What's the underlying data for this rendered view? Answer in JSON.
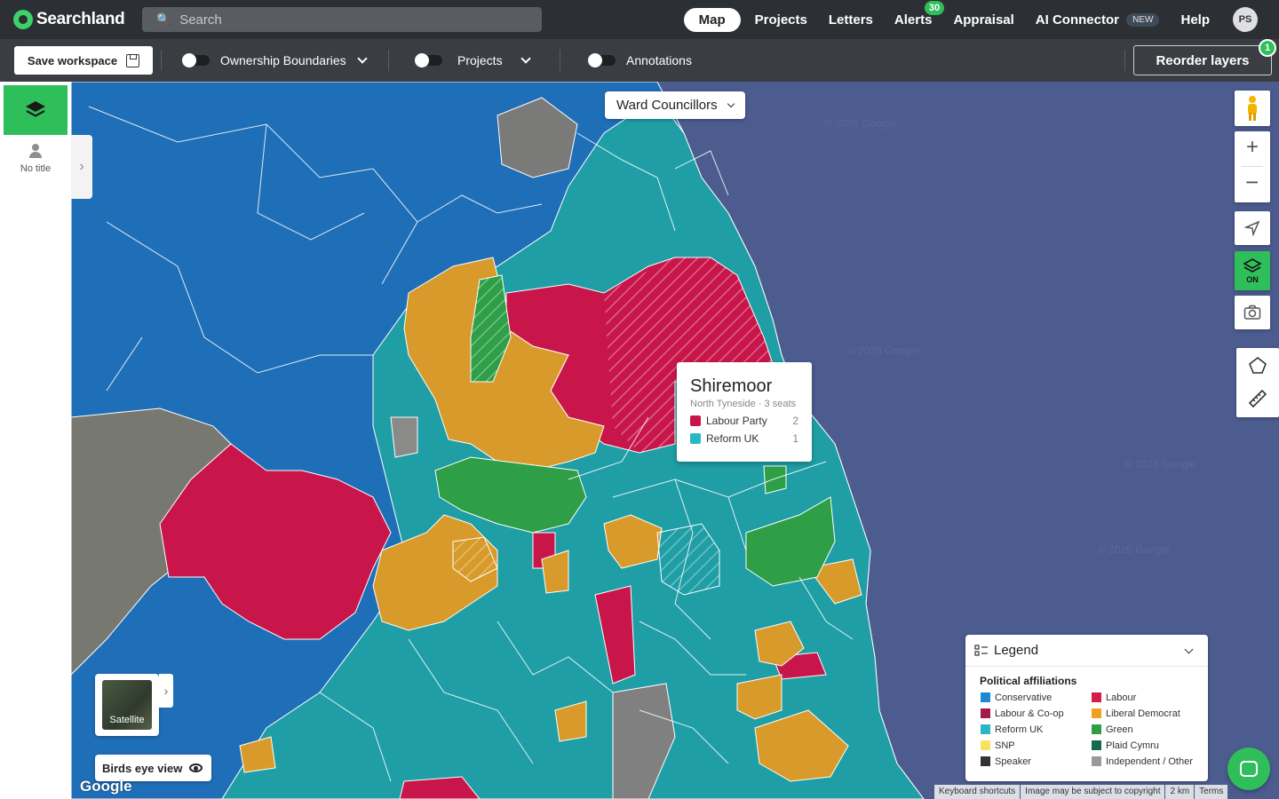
{
  "brand": {
    "name": "Searchland"
  },
  "search": {
    "placeholder": "Search"
  },
  "nav": {
    "map": "Map",
    "projects": "Projects",
    "letters": "Letters",
    "alerts": "Alerts",
    "alerts_count": "30",
    "appraisal": "Appraisal",
    "ai_connector": "AI Connector",
    "new_badge": "NEW",
    "help": "Help",
    "avatar_initials": "PS"
  },
  "toolbar": {
    "save_label": "Save workspace",
    "ownership": "Ownership Boundaries",
    "projects": "Projects",
    "annotations": "Annotations",
    "reorder_label": "Reorder layers",
    "reorder_count": "1"
  },
  "left_panel": {
    "workspace_title": "No title"
  },
  "map": {
    "layer_dropdown": "Ward Councillors",
    "layers_toggle_state": "ON",
    "popup": {
      "title": "Shiremoor",
      "subtitle": "North Tyneside · 3 seats",
      "rows": [
        {
          "party": "Labour Party",
          "count": "2",
          "color": "#c8164a"
        },
        {
          "party": "Reform UK",
          "count": "1",
          "color": "#2bb6c6"
        }
      ]
    },
    "satellite_label": "Satellite",
    "birds_eye_label": "Birds eye view",
    "google_label": "Google",
    "watermark": "© 2026 Google",
    "attribution": [
      "Keyboard shortcuts",
      "Image may be subject to copyright",
      "2 km",
      "Terms"
    ]
  },
  "legend": {
    "title": "Legend",
    "subtitle": "Political affiliations",
    "items": [
      {
        "label": "Conservative",
        "color": "#1e88d8"
      },
      {
        "label": "Labour",
        "color": "#d61a4a"
      },
      {
        "label": "Labour & Co-op",
        "color": "#a61a4a"
      },
      {
        "label": "Liberal Democrat",
        "color": "#f29e1f"
      },
      {
        "label": "Reform UK",
        "color": "#2bb6c6"
      },
      {
        "label": "Green",
        "color": "#2e9e47"
      },
      {
        "label": "SNP",
        "color": "#f7e35f"
      },
      {
        "label": "Plaid Cymru",
        "color": "#136b4a"
      },
      {
        "label": "Speaker",
        "color": "#333333"
      },
      {
        "label": "Independent / Other",
        "color": "#9a9a9a"
      }
    ]
  },
  "colors": {
    "brand_green": "#2fbf5a",
    "conservative_area": "#1f6fb8",
    "reform_area": "#1f9ea5",
    "labour_area": "#c8164a",
    "libdem_area": "#d89a2a",
    "green_area": "#2e9e47",
    "sea": "#4c5c8f"
  }
}
